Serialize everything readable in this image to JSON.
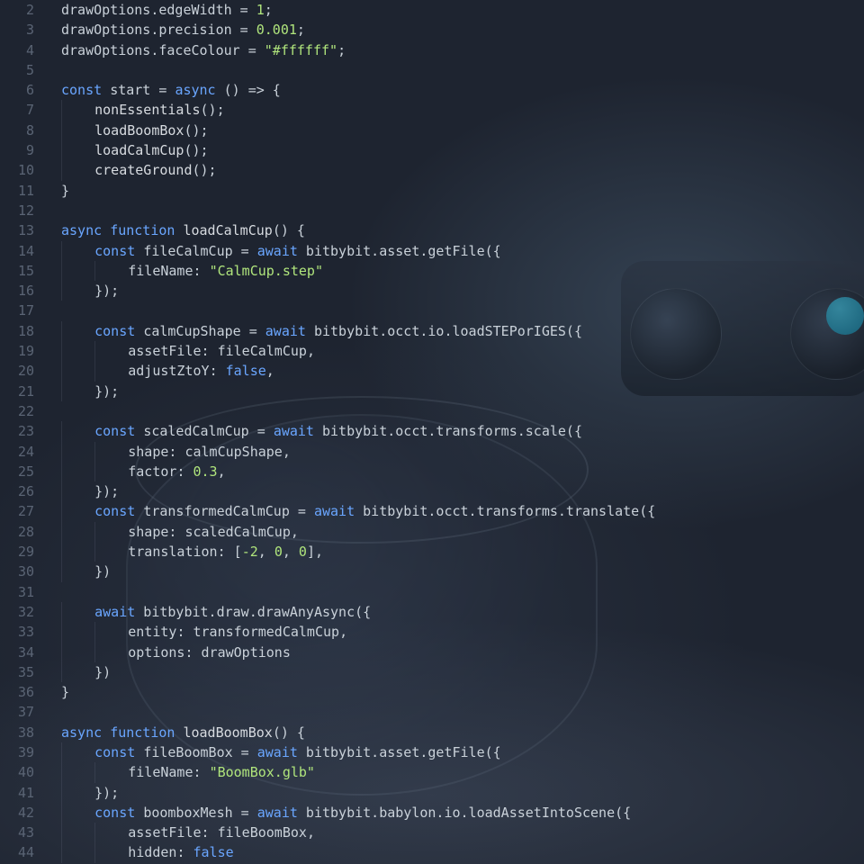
{
  "editor": {
    "first_line_no": 2,
    "syntax_colors": {
      "keyword": "#6aa6ff",
      "string": "#b0e57c",
      "number": "#b0e57c",
      "boolean": "#6aa6ff",
      "default": "#c9d1d9",
      "gutter": "#5a6474"
    },
    "lines": [
      {
        "n": 2,
        "indent": 0,
        "tokens": [
          [
            "id",
            "drawOptions"
          ],
          [
            "pun",
            "."
          ],
          [
            "prop",
            "edgeWidth"
          ],
          [
            "pun",
            " = "
          ],
          [
            "num",
            "1"
          ],
          [
            "pun",
            ";"
          ]
        ]
      },
      {
        "n": 3,
        "indent": 0,
        "tokens": [
          [
            "id",
            "drawOptions"
          ],
          [
            "pun",
            "."
          ],
          [
            "prop",
            "precision"
          ],
          [
            "pun",
            " = "
          ],
          [
            "num",
            "0.001"
          ],
          [
            "pun",
            ";"
          ]
        ]
      },
      {
        "n": 4,
        "indent": 0,
        "tokens": [
          [
            "id",
            "drawOptions"
          ],
          [
            "pun",
            "."
          ],
          [
            "prop",
            "faceColour"
          ],
          [
            "pun",
            " = "
          ],
          [
            "str",
            "\"#ffffff\""
          ],
          [
            "pun",
            ";"
          ]
        ]
      },
      {
        "n": 5,
        "indent": 0,
        "tokens": []
      },
      {
        "n": 6,
        "indent": 0,
        "tokens": [
          [
            "kw",
            "const"
          ],
          [
            "pun",
            " "
          ],
          [
            "id",
            "start"
          ],
          [
            "pun",
            " = "
          ],
          [
            "mod",
            "async"
          ],
          [
            "pun",
            " () => {"
          ]
        ]
      },
      {
        "n": 7,
        "indent": 1,
        "tokens": [
          [
            "fn",
            "nonEssentials"
          ],
          [
            "pun",
            "();"
          ]
        ]
      },
      {
        "n": 8,
        "indent": 1,
        "tokens": [
          [
            "fn",
            "loadBoomBox"
          ],
          [
            "pun",
            "();"
          ]
        ]
      },
      {
        "n": 9,
        "indent": 1,
        "tokens": [
          [
            "fn",
            "loadCalmCup"
          ],
          [
            "pun",
            "();"
          ]
        ]
      },
      {
        "n": 10,
        "indent": 1,
        "tokens": [
          [
            "fn",
            "createGround"
          ],
          [
            "pun",
            "();"
          ]
        ]
      },
      {
        "n": 11,
        "indent": 0,
        "tokens": [
          [
            "pun",
            "}"
          ]
        ]
      },
      {
        "n": 12,
        "indent": 0,
        "tokens": []
      },
      {
        "n": 13,
        "indent": 0,
        "tokens": [
          [
            "mod",
            "async"
          ],
          [
            "pun",
            " "
          ],
          [
            "kw",
            "function"
          ],
          [
            "pun",
            " "
          ],
          [
            "fn",
            "loadCalmCup"
          ],
          [
            "pun",
            "() {"
          ]
        ]
      },
      {
        "n": 14,
        "indent": 1,
        "tokens": [
          [
            "kw",
            "const"
          ],
          [
            "pun",
            " "
          ],
          [
            "id",
            "fileCalmCup"
          ],
          [
            "pun",
            " = "
          ],
          [
            "kw",
            "await"
          ],
          [
            "pun",
            " bitbybit.asset.getFile({"
          ]
        ]
      },
      {
        "n": 15,
        "indent": 2,
        "tokens": [
          [
            "prop",
            "fileName"
          ],
          [
            "pun",
            ": "
          ],
          [
            "str",
            "\"CalmCup.step\""
          ]
        ]
      },
      {
        "n": 16,
        "indent": 1,
        "tokens": [
          [
            "pun",
            "});"
          ]
        ]
      },
      {
        "n": 17,
        "indent": 0,
        "tokens": []
      },
      {
        "n": 18,
        "indent": 1,
        "tokens": [
          [
            "kw",
            "const"
          ],
          [
            "pun",
            " "
          ],
          [
            "id",
            "calmCupShape"
          ],
          [
            "pun",
            " = "
          ],
          [
            "kw",
            "await"
          ],
          [
            "pun",
            " bitbybit.occt.io.loadSTEPorIGES({"
          ]
        ]
      },
      {
        "n": 19,
        "indent": 2,
        "tokens": [
          [
            "prop",
            "assetFile"
          ],
          [
            "pun",
            ": "
          ],
          [
            "id",
            "fileCalmCup"
          ],
          [
            "pun",
            ","
          ]
        ]
      },
      {
        "n": 20,
        "indent": 2,
        "tokens": [
          [
            "prop",
            "adjustZtoY"
          ],
          [
            "pun",
            ": "
          ],
          [
            "bool",
            "false"
          ],
          [
            "pun",
            ","
          ]
        ]
      },
      {
        "n": 21,
        "indent": 1,
        "tokens": [
          [
            "pun",
            "});"
          ]
        ]
      },
      {
        "n": 22,
        "indent": 0,
        "tokens": []
      },
      {
        "n": 23,
        "indent": 1,
        "tokens": [
          [
            "kw",
            "const"
          ],
          [
            "pun",
            " "
          ],
          [
            "id",
            "scaledCalmCup"
          ],
          [
            "pun",
            " = "
          ],
          [
            "kw",
            "await"
          ],
          [
            "pun",
            " bitbybit.occt.transforms.scale({"
          ]
        ]
      },
      {
        "n": 24,
        "indent": 2,
        "tokens": [
          [
            "prop",
            "shape"
          ],
          [
            "pun",
            ": "
          ],
          [
            "id",
            "calmCupShape"
          ],
          [
            "pun",
            ","
          ]
        ]
      },
      {
        "n": 25,
        "indent": 2,
        "tokens": [
          [
            "prop",
            "factor"
          ],
          [
            "pun",
            ": "
          ],
          [
            "num",
            "0.3"
          ],
          [
            "pun",
            ","
          ]
        ]
      },
      {
        "n": 26,
        "indent": 1,
        "tokens": [
          [
            "pun",
            "});"
          ]
        ]
      },
      {
        "n": 27,
        "indent": 1,
        "tokens": [
          [
            "kw",
            "const"
          ],
          [
            "pun",
            " "
          ],
          [
            "id",
            "transformedCalmCup"
          ],
          [
            "pun",
            " = "
          ],
          [
            "kw",
            "await"
          ],
          [
            "pun",
            " bitbybit.occt.transforms.translate({"
          ]
        ]
      },
      {
        "n": 28,
        "indent": 2,
        "tokens": [
          [
            "prop",
            "shape"
          ],
          [
            "pun",
            ": "
          ],
          [
            "id",
            "scaledCalmCup"
          ],
          [
            "pun",
            ","
          ]
        ]
      },
      {
        "n": 29,
        "indent": 2,
        "tokens": [
          [
            "prop",
            "translation"
          ],
          [
            "pun",
            ": ["
          ],
          [
            "num",
            "-2"
          ],
          [
            "pun",
            ", "
          ],
          [
            "num",
            "0"
          ],
          [
            "pun",
            ", "
          ],
          [
            "num",
            "0"
          ],
          [
            "pun",
            "],"
          ]
        ]
      },
      {
        "n": 30,
        "indent": 1,
        "tokens": [
          [
            "pun",
            "})"
          ]
        ]
      },
      {
        "n": 31,
        "indent": 0,
        "tokens": []
      },
      {
        "n": 32,
        "indent": 1,
        "tokens": [
          [
            "kw",
            "await"
          ],
          [
            "pun",
            " bitbybit.draw.drawAnyAsync({"
          ]
        ]
      },
      {
        "n": 33,
        "indent": 2,
        "tokens": [
          [
            "prop",
            "entity"
          ],
          [
            "pun",
            ": "
          ],
          [
            "id",
            "transformedCalmCup"
          ],
          [
            "pun",
            ","
          ]
        ]
      },
      {
        "n": 34,
        "indent": 2,
        "tokens": [
          [
            "prop",
            "options"
          ],
          [
            "pun",
            ": "
          ],
          [
            "id",
            "drawOptions"
          ]
        ]
      },
      {
        "n": 35,
        "indent": 1,
        "tokens": [
          [
            "pun",
            "})"
          ]
        ]
      },
      {
        "n": 36,
        "indent": 0,
        "tokens": [
          [
            "pun",
            "}"
          ]
        ]
      },
      {
        "n": 37,
        "indent": 0,
        "tokens": []
      },
      {
        "n": 38,
        "indent": 0,
        "tokens": [
          [
            "mod",
            "async"
          ],
          [
            "pun",
            " "
          ],
          [
            "kw",
            "function"
          ],
          [
            "pun",
            " "
          ],
          [
            "fn",
            "loadBoomBox"
          ],
          [
            "pun",
            "() {"
          ]
        ]
      },
      {
        "n": 39,
        "indent": 1,
        "tokens": [
          [
            "kw",
            "const"
          ],
          [
            "pun",
            " "
          ],
          [
            "id",
            "fileBoomBox"
          ],
          [
            "pun",
            " = "
          ],
          [
            "kw",
            "await"
          ],
          [
            "pun",
            " bitbybit.asset.getFile({"
          ]
        ]
      },
      {
        "n": 40,
        "indent": 2,
        "tokens": [
          [
            "prop",
            "fileName"
          ],
          [
            "pun",
            ": "
          ],
          [
            "str",
            "\"BoomBox.glb\""
          ]
        ]
      },
      {
        "n": 41,
        "indent": 1,
        "tokens": [
          [
            "pun",
            "});"
          ]
        ]
      },
      {
        "n": 42,
        "indent": 1,
        "tokens": [
          [
            "kw",
            "const"
          ],
          [
            "pun",
            " "
          ],
          [
            "id",
            "boomboxMesh"
          ],
          [
            "pun",
            " = "
          ],
          [
            "kw",
            "await"
          ],
          [
            "pun",
            " bitbybit.babylon.io.loadAssetIntoScene({"
          ]
        ]
      },
      {
        "n": 43,
        "indent": 2,
        "tokens": [
          [
            "prop",
            "assetFile"
          ],
          [
            "pun",
            ": "
          ],
          [
            "id",
            "fileBoomBox"
          ],
          [
            "pun",
            ","
          ]
        ]
      },
      {
        "n": 44,
        "indent": 2,
        "tokens": [
          [
            "prop",
            "hidden"
          ],
          [
            "pun",
            ": "
          ],
          [
            "bool",
            "false"
          ]
        ]
      }
    ]
  }
}
